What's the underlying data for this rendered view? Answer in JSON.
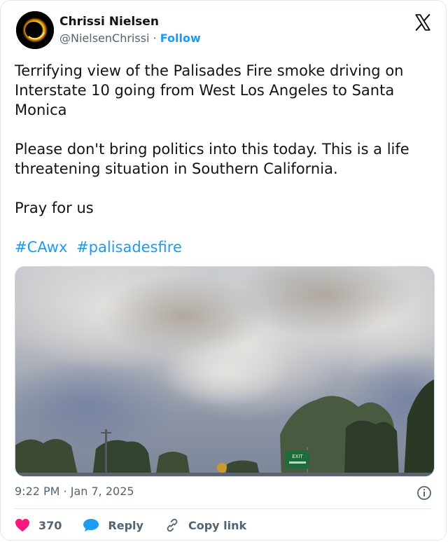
{
  "author": {
    "name": "Chrissi Nielsen",
    "handle": "@NielsenChrissi",
    "separator": "·",
    "follow_label": "Follow"
  },
  "tweet": {
    "lines": [
      "Terrifying view of the Palisades Fire smoke driving on Interstate 10 going from West Los Angeles to Santa Monica",
      "Please don't bring politics into this today. This is a life threatening situation in Southern California.",
      "Pray for us"
    ],
    "hashtags": [
      "#CAwx",
      "#palisadesfire"
    ]
  },
  "media": {
    "sign_text": "EXIT"
  },
  "meta": {
    "time": "9:22 PM",
    "separator": "·",
    "date": "Jan 7, 2025"
  },
  "actions": {
    "likes": "370",
    "reply_label": "Reply",
    "copy_label": "Copy link"
  },
  "icons": {
    "logo": "x-logo-icon",
    "like": "heart-icon",
    "reply": "speech-bubble-icon",
    "copy": "link-icon",
    "info": "info-icon"
  },
  "colors": {
    "accent": "#1d9bf0",
    "like": "#f91880",
    "text": "#0f1419",
    "secondary": "#536471"
  }
}
